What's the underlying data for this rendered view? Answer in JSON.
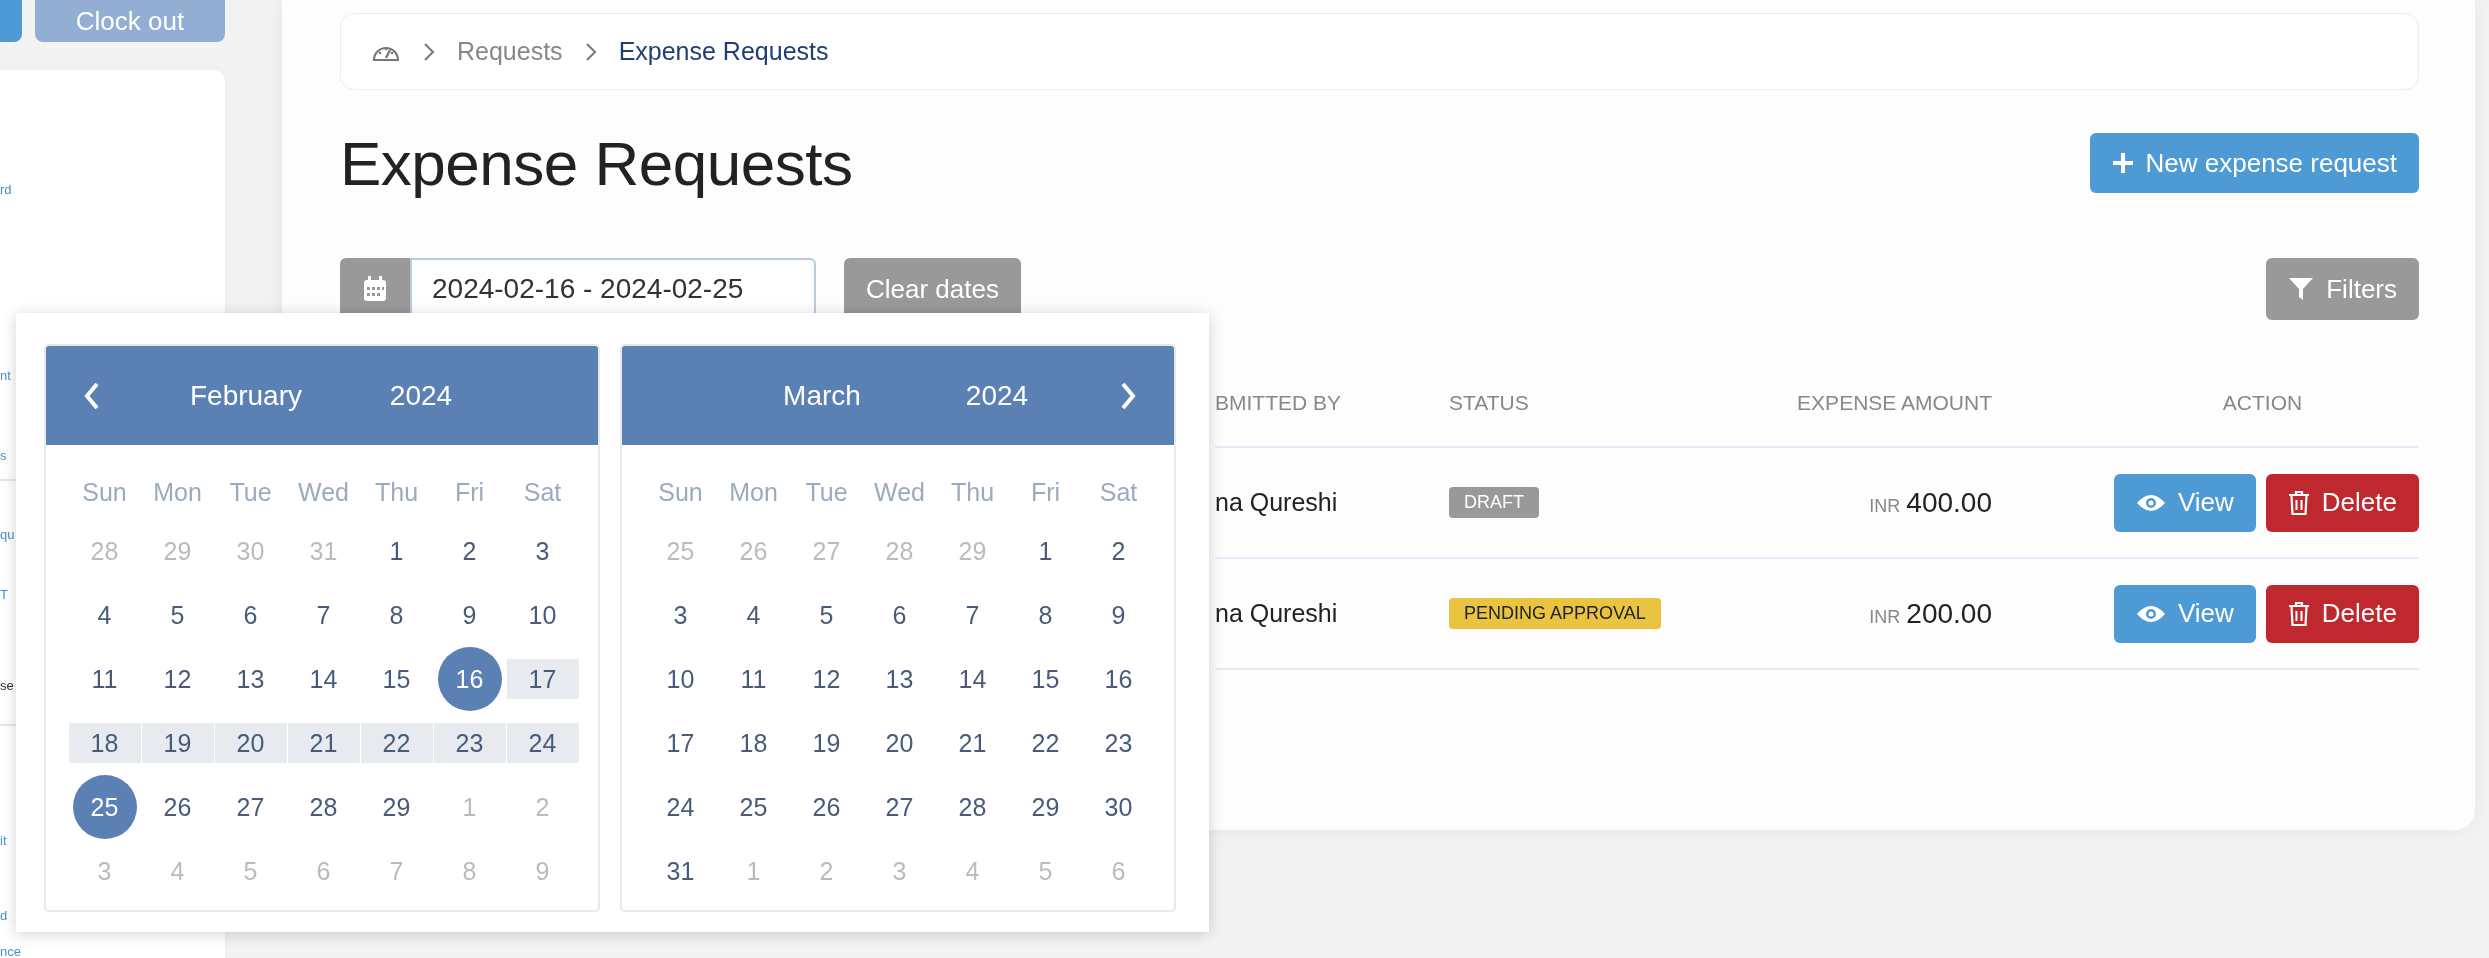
{
  "top_bar": {
    "clock_out_button": "Clock out"
  },
  "sidebar": {
    "groups": [
      [
        {
          "label": "rd",
          "selected": false
        }
      ],
      [
        {
          "label": "nt",
          "selected": false
        },
        {
          "label": "s",
          "selected": false
        }
      ],
      [
        {
          "label": "qu",
          "selected": false
        },
        {
          "label": "T",
          "selected": false
        },
        {
          "label": "se",
          "selected": true
        }
      ],
      [
        {
          "label": "it",
          "selected": false
        },
        {
          "label": "d",
          "selected": false
        },
        {
          "label": "nce",
          "selected": false
        }
      ]
    ]
  },
  "breadcrumb": [
    {
      "label": "Requests",
      "current": false
    },
    {
      "label": "Expense Requests",
      "current": true
    }
  ],
  "page_title": "Expense Requests",
  "new_button": "New expense request",
  "date_filter": {
    "value": "2024-02-16 - 2024-02-25",
    "clear_button": "Clear dates"
  },
  "filters_button": "Filters",
  "table": {
    "columns": [
      "BMITTED BY",
      "STATUS",
      "EXPENSE AMOUNT",
      "ACTION"
    ],
    "rows": [
      {
        "submitted_by": "na Qureshi",
        "status": {
          "label": "DRAFT",
          "kind": "draft"
        },
        "currency": "INR",
        "amount": "400.00",
        "actions": [
          "View",
          "Delete"
        ]
      },
      {
        "submitted_by": "na Qureshi",
        "status": {
          "label": "PENDING APPROVAL",
          "kind": "pending"
        },
        "currency": "INR",
        "amount": "200.00",
        "actions": [
          "View",
          "Delete"
        ]
      }
    ]
  },
  "datepicker": {
    "months": [
      {
        "month": "February",
        "year": "2024",
        "weekdays": [
          "Sun",
          "Mon",
          "Tue",
          "Wed",
          "Thu",
          "Fri",
          "Sat"
        ],
        "weeks": [
          [
            {
              "day": "28",
              "outside": true,
              "selected": false,
              "in_range": false
            },
            {
              "day": "29",
              "outside": true,
              "selected": false,
              "in_range": false
            },
            {
              "day": "30",
              "outside": true,
              "selected": false,
              "in_range": false
            },
            {
              "day": "31",
              "outside": true,
              "selected": false,
              "in_range": false
            },
            {
              "day": "1",
              "outside": false,
              "selected": false,
              "in_range": false
            },
            {
              "day": "2",
              "outside": false,
              "selected": false,
              "in_range": false
            },
            {
              "day": "3",
              "outside": false,
              "selected": false,
              "in_range": false
            }
          ],
          [
            {
              "day": "4",
              "outside": false,
              "selected": false,
              "in_range": false
            },
            {
              "day": "5",
              "outside": false,
              "selected": false,
              "in_range": false
            },
            {
              "day": "6",
              "outside": false,
              "selected": false,
              "in_range": false
            },
            {
              "day": "7",
              "outside": false,
              "selected": false,
              "in_range": false
            },
            {
              "day": "8",
              "outside": false,
              "selected": false,
              "in_range": false
            },
            {
              "day": "9",
              "outside": false,
              "selected": false,
              "in_range": false
            },
            {
              "day": "10",
              "outside": false,
              "selected": false,
              "in_range": false
            }
          ],
          [
            {
              "day": "11",
              "outside": false,
              "selected": false,
              "in_range": false
            },
            {
              "day": "12",
              "outside": false,
              "selected": false,
              "in_range": false
            },
            {
              "day": "13",
              "outside": false,
              "selected": false,
              "in_range": false
            },
            {
              "day": "14",
              "outside": false,
              "selected": false,
              "in_range": false
            },
            {
              "day": "15",
              "outside": false,
              "selected": false,
              "in_range": false
            },
            {
              "day": "16",
              "outside": false,
              "selected": true,
              "in_range": false
            },
            {
              "day": "17",
              "outside": false,
              "selected": false,
              "in_range": true
            }
          ],
          [
            {
              "day": "18",
              "outside": false,
              "selected": false,
              "in_range": true
            },
            {
              "day": "19",
              "outside": false,
              "selected": false,
              "in_range": true
            },
            {
              "day": "20",
              "outside": false,
              "selected": false,
              "in_range": true
            },
            {
              "day": "21",
              "outside": false,
              "selected": false,
              "in_range": true
            },
            {
              "day": "22",
              "outside": false,
              "selected": false,
              "in_range": true
            },
            {
              "day": "23",
              "outside": false,
              "selected": false,
              "in_range": true
            },
            {
              "day": "24",
              "outside": false,
              "selected": false,
              "in_range": true
            }
          ],
          [
            {
              "day": "25",
              "outside": false,
              "selected": true,
              "in_range": false
            },
            {
              "day": "26",
              "outside": false,
              "selected": false,
              "in_range": false
            },
            {
              "day": "27",
              "outside": false,
              "selected": false,
              "in_range": false
            },
            {
              "day": "28",
              "outside": false,
              "selected": false,
              "in_range": false
            },
            {
              "day": "29",
              "outside": false,
              "selected": false,
              "in_range": false
            },
            {
              "day": "1",
              "outside": true,
              "selected": false,
              "in_range": false
            },
            {
              "day": "2",
              "outside": true,
              "selected": false,
              "in_range": false
            }
          ],
          [
            {
              "day": "3",
              "outside": true,
              "selected": false,
              "in_range": false
            },
            {
              "day": "4",
              "outside": true,
              "selected": false,
              "in_range": false
            },
            {
              "day": "5",
              "outside": true,
              "selected": false,
              "in_range": false
            },
            {
              "day": "6",
              "outside": true,
              "selected": false,
              "in_range": false
            },
            {
              "day": "7",
              "outside": true,
              "selected": false,
              "in_range": false
            },
            {
              "day": "8",
              "outside": true,
              "selected": false,
              "in_range": false
            },
            {
              "day": "9",
              "outside": true,
              "selected": false,
              "in_range": false
            }
          ]
        ]
      },
      {
        "month": "March",
        "year": "2024",
        "weekdays": [
          "Sun",
          "Mon",
          "Tue",
          "Wed",
          "Thu",
          "Fri",
          "Sat"
        ],
        "weeks": [
          [
            {
              "day": "25",
              "outside": true,
              "selected": false,
              "in_range": false
            },
            {
              "day": "26",
              "outside": true,
              "selected": false,
              "in_range": false
            },
            {
              "day": "27",
              "outside": true,
              "selected": false,
              "in_range": false
            },
            {
              "day": "28",
              "outside": true,
              "selected": false,
              "in_range": false
            },
            {
              "day": "29",
              "outside": true,
              "selected": false,
              "in_range": false
            },
            {
              "day": "1",
              "outside": false,
              "selected": false,
              "in_range": false
            },
            {
              "day": "2",
              "outside": false,
              "selected": false,
              "in_range": false
            }
          ],
          [
            {
              "day": "3",
              "outside": false,
              "selected": false,
              "in_range": false
            },
            {
              "day": "4",
              "outside": false,
              "selected": false,
              "in_range": false
            },
            {
              "day": "5",
              "outside": false,
              "selected": false,
              "in_range": false
            },
            {
              "day": "6",
              "outside": false,
              "selected": false,
              "in_range": false
            },
            {
              "day": "7",
              "outside": false,
              "selected": false,
              "in_range": false
            },
            {
              "day": "8",
              "outside": false,
              "selected": false,
              "in_range": false
            },
            {
              "day": "9",
              "outside": false,
              "selected": false,
              "in_range": false
            }
          ],
          [
            {
              "day": "10",
              "outside": false,
              "selected": false,
              "in_range": false
            },
            {
              "day": "11",
              "outside": false,
              "selected": false,
              "in_range": false
            },
            {
              "day": "12",
              "outside": false,
              "selected": false,
              "in_range": false
            },
            {
              "day": "13",
              "outside": false,
              "selected": false,
              "in_range": false
            },
            {
              "day": "14",
              "outside": false,
              "selected": false,
              "in_range": false
            },
            {
              "day": "15",
              "outside": false,
              "selected": false,
              "in_range": false
            },
            {
              "day": "16",
              "outside": false,
              "selected": false,
              "in_range": false
            }
          ],
          [
            {
              "day": "17",
              "outside": false,
              "selected": false,
              "in_range": false
            },
            {
              "day": "18",
              "outside": false,
              "selected": false,
              "in_range": false
            },
            {
              "day": "19",
              "outside": false,
              "selected": false,
              "in_range": false
            },
            {
              "day": "20",
              "outside": false,
              "selected": false,
              "in_range": false
            },
            {
              "day": "21",
              "outside": false,
              "selected": false,
              "in_range": false
            },
            {
              "day": "22",
              "outside": false,
              "selected": false,
              "in_range": false
            },
            {
              "day": "23",
              "outside": false,
              "selected": false,
              "in_range": false
            }
          ],
          [
            {
              "day": "24",
              "outside": false,
              "selected": false,
              "in_range": false
            },
            {
              "day": "25",
              "outside": false,
              "selected": false,
              "in_range": false
            },
            {
              "day": "26",
              "outside": false,
              "selected": false,
              "in_range": false
            },
            {
              "day": "27",
              "outside": false,
              "selected": false,
              "in_range": false
            },
            {
              "day": "28",
              "outside": false,
              "selected": false,
              "in_range": false
            },
            {
              "day": "29",
              "outside": false,
              "selected": false,
              "in_range": false
            },
            {
              "day": "30",
              "outside": false,
              "selected": false,
              "in_range": false
            }
          ],
          [
            {
              "day": "31",
              "outside": false,
              "selected": false,
              "in_range": false
            },
            {
              "day": "1",
              "outside": true,
              "selected": false,
              "in_range": false
            },
            {
              "day": "2",
              "outside": true,
              "selected": false,
              "in_range": false
            },
            {
              "day": "3",
              "outside": true,
              "selected": false,
              "in_range": false
            },
            {
              "day": "4",
              "outside": true,
              "selected": false,
              "in_range": false
            },
            {
              "day": "5",
              "outside": true,
              "selected": false,
              "in_range": false
            },
            {
              "day": "6",
              "outside": true,
              "selected": false,
              "in_range": false
            }
          ]
        ]
      }
    ]
  }
}
